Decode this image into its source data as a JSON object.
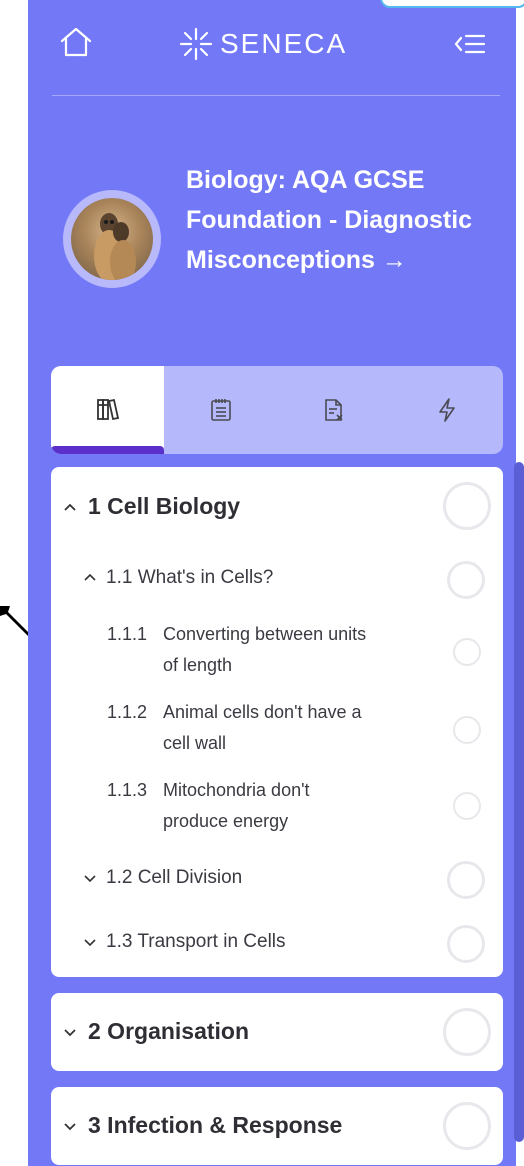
{
  "brand": {
    "name": "SENECA",
    "logo_icon": "seneca-burst-icon"
  },
  "header": {
    "home_icon": "home-icon",
    "collapse_icon": "collapse-menu-icon"
  },
  "course": {
    "title": "Biology: AQA GCSE Foundation - Diagnostic Misconceptions →",
    "avatar_icon": "meerkat-avatar"
  },
  "tabs": [
    {
      "icon": "library-books-icon",
      "active": true
    },
    {
      "icon": "notebook-icon",
      "active": false
    },
    {
      "icon": "document-x-icon",
      "active": false
    },
    {
      "icon": "lightning-icon",
      "active": false
    }
  ],
  "sections": [
    {
      "label": "1 Cell Biology",
      "expanded": true,
      "subsections": [
        {
          "label": "1.1 What's in Cells?",
          "expanded": true,
          "items": [
            {
              "number": "1.1.1",
              "line1": "Converting between units",
              "line2": "of length"
            },
            {
              "number": "1.1.2",
              "line1": "Animal cells don't have a",
              "line2": "cell wall"
            },
            {
              "number": "1.1.3",
              "line1": "Mitochondria don't",
              "line2": "produce energy"
            }
          ]
        },
        {
          "label": "1.2 Cell Division",
          "expanded": false
        },
        {
          "label": "1.3 Transport in Cells",
          "expanded": false
        }
      ]
    },
    {
      "label": "2 Organisation",
      "expanded": false
    },
    {
      "label": "3 Infection & Response",
      "expanded": false
    }
  ],
  "colors": {
    "sidebar_bg": "#7378f7",
    "tab_bar_bg": "#b5b8fb",
    "active_tab_underline": "#5b2fc9",
    "progress_ring": "#e8e8ec"
  }
}
